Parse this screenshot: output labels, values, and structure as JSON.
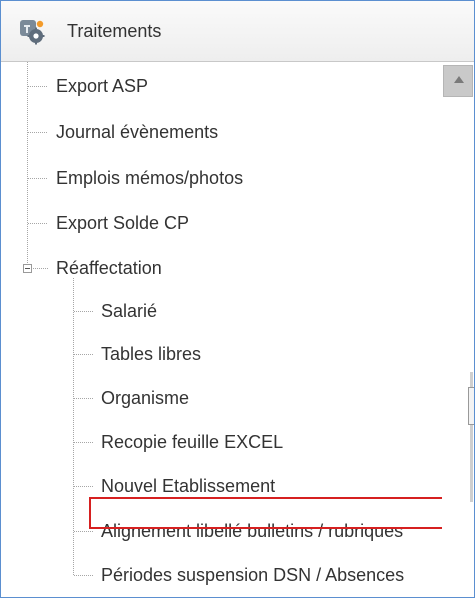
{
  "panel": {
    "title": "Traitements",
    "title_icon": "gear-settings-icon"
  },
  "tree": {
    "items": [
      {
        "label": "Export ASP"
      },
      {
        "label": "Journal évènements"
      },
      {
        "label": "Emplois mémos/photos"
      },
      {
        "label": "Export Solde CP"
      },
      {
        "label": "Réaffectation",
        "expanded": true,
        "children": [
          {
            "label": "Salarié"
          },
          {
            "label": "Tables libres"
          },
          {
            "label": "Organisme"
          },
          {
            "label": "Recopie feuille EXCEL"
          },
          {
            "label": "Nouvel Etablissement"
          },
          {
            "label": "Alignement libellé bulletins / rubriques"
          },
          {
            "label": "Périodes suspension DSN / Absences",
            "highlighted": true
          }
        ]
      }
    ]
  },
  "scrollbar": {
    "up_icon": "arrow-up-icon"
  },
  "colors": {
    "panel_border": "#5b8fd0",
    "highlight": "#d62020",
    "text": "#333333"
  }
}
